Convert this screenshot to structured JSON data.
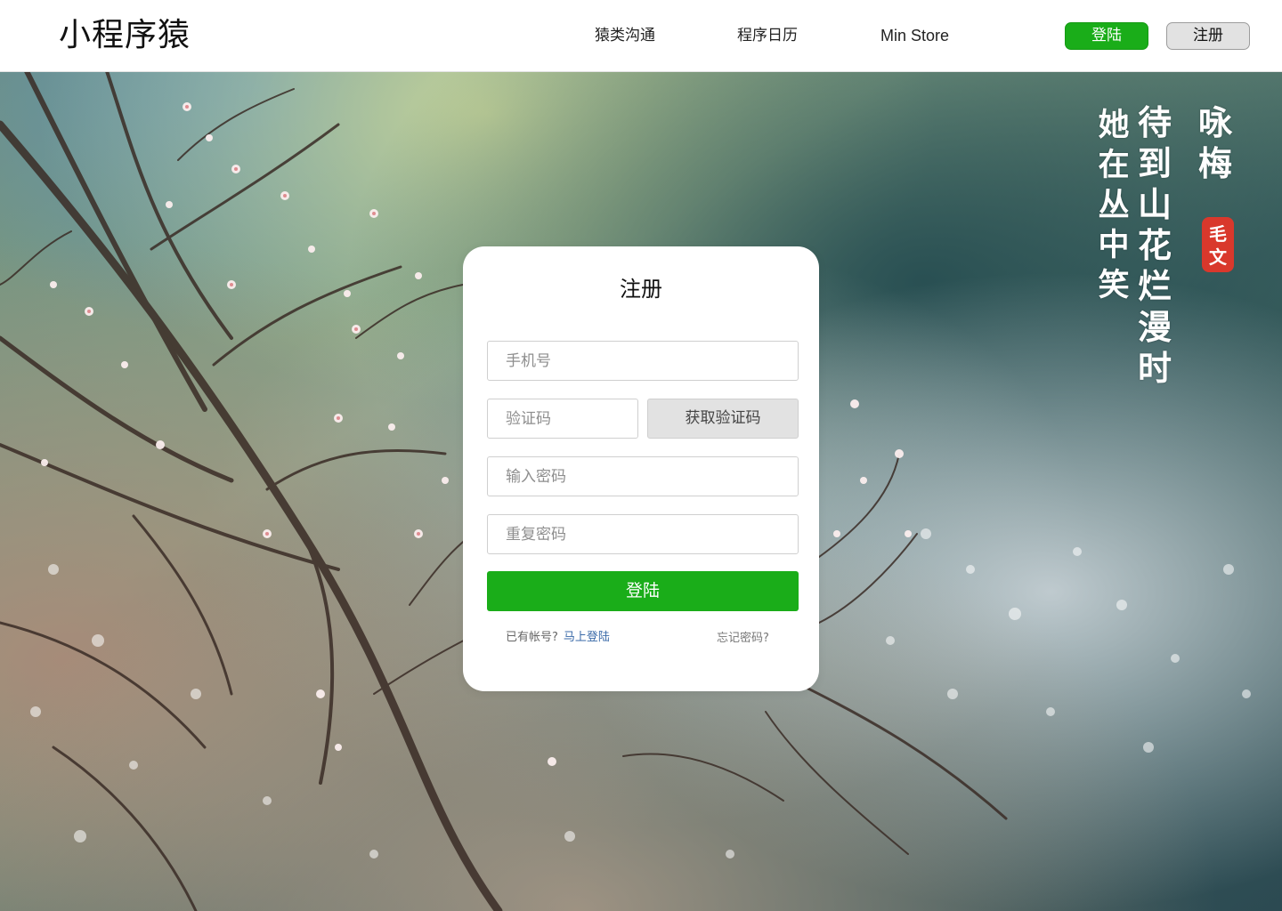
{
  "header": {
    "logo": "小程序猿",
    "nav": [
      {
        "label": "猿类沟通"
      },
      {
        "label": "程序日历"
      },
      {
        "label": "Min Store"
      }
    ],
    "login_label": "登陆",
    "register_label": "注册"
  },
  "poem": {
    "title": "咏梅",
    "lines": [
      "待到山花烂漫时",
      "她在丛中笑"
    ],
    "seal": "毛文"
  },
  "form": {
    "title": "注册",
    "phone_placeholder": "手机号",
    "code_placeholder": "验证码",
    "get_code_label": "获取验证码",
    "password_placeholder": "输入密码",
    "repeat_password_placeholder": "重复密码",
    "submit_label": "登陆",
    "has_account_text": "已有帐号?",
    "login_now_link": "马上登陆",
    "forgot_password_link": "忘记密码?"
  },
  "colors": {
    "primary_green": "#1aad19",
    "secondary_gray": "#e2e2e2",
    "link_blue": "#3a6aa8",
    "seal_red": "#d9382c"
  }
}
